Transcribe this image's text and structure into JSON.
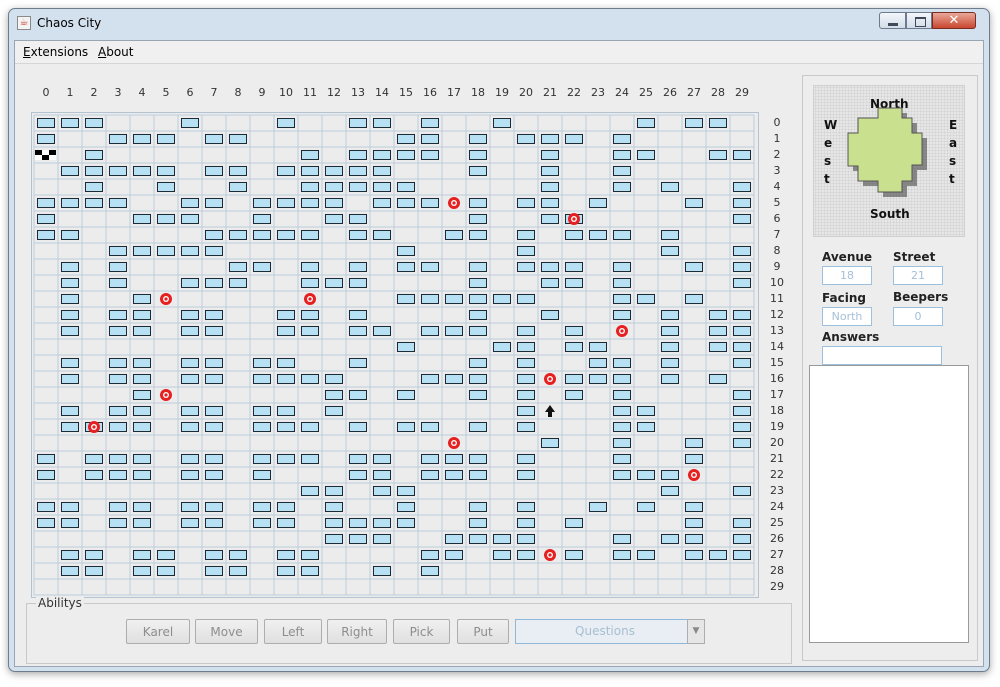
{
  "window": {
    "title": "Chaos City",
    "close_glyph": "✕"
  },
  "menu": {
    "items": [
      "Extensions",
      "About"
    ]
  },
  "grid": {
    "columns": 30,
    "rows": 30,
    "column_labels": [
      "0",
      "1",
      "2",
      "3",
      "4",
      "5",
      "6",
      "7",
      "8",
      "9",
      "10",
      "11",
      "12",
      "13",
      "14",
      "15",
      "16",
      "17",
      "18",
      "19",
      "20",
      "21",
      "22",
      "23",
      "24",
      "25",
      "26",
      "27",
      "28",
      "29"
    ],
    "row_labels": [
      "0",
      "1",
      "2",
      "3",
      "4",
      "5",
      "6",
      "7",
      "8",
      "9",
      "10",
      "11",
      "12",
      "13",
      "14",
      "15",
      "16",
      "17",
      "18",
      "19",
      "20",
      "21",
      "22",
      "23",
      "24",
      "25",
      "26",
      "27",
      "28",
      "29"
    ],
    "walls": [
      "111000100010011010010000010110",
      "100111011000000110101110100000",
      "001000000001011110100100110011",
      "011111011011111000100100100000",
      "001001001001111100000100101001",
      "111100110111101110101101000101",
      "100011100100110000100110000001",
      "110000011111011001101011101000",
      "000111110000000100001000001001",
      "010100001101010110101110100101",
      "010100111001110000100110100001",
      "010010000000000111111000110100",
      "010110110011010000100100101011",
      "010110110011011011101010001011",
      "000000000000000100011011001011",
      "010110110110010000101001101001",
      "010110110111100011101011101010",
      "000010000000110100101010100001",
      "010110110110100000001000110001",
      "011110110111010110101000110001",
      "000000000000000000000100100101",
      "101110110111011011101000100100",
      "101110110100011011101000111000",
      "000000000001101100000000001001",
      "110110110110100100101001010100",
      "110110110110111100101010000101",
      "000000000000111001111000101101",
      "011011011011000011011010110111",
      "011011011011001010000000000000",
      "000000000000000000000000000000"
    ],
    "beepers": [
      [
        17,
        5
      ],
      [
        22,
        6
      ],
      [
        5,
        11
      ],
      [
        11,
        11
      ],
      [
        24,
        13
      ],
      [
        21,
        16
      ],
      [
        5,
        17
      ],
      [
        2,
        19
      ],
      [
        17,
        20
      ],
      [
        27,
        22
      ],
      [
        21,
        27
      ]
    ],
    "home": {
      "avenue": 0,
      "street": 2
    },
    "robot": {
      "avenue": 21,
      "street": 18,
      "facing": "North",
      "glyph": "▲"
    }
  },
  "abilitys": {
    "label": "Abilitys",
    "buttons": [
      "Karel",
      "Move",
      "Left",
      "Right",
      "Pick",
      "Put"
    ],
    "questions_placeholder": "Questions",
    "dropdown_glyph": "▼"
  },
  "compass": {
    "north": "North",
    "south": "South",
    "west": "W\ne\ns\nt",
    "east": "E\na\ns\nt"
  },
  "status": {
    "avenue_label": "Avenue",
    "avenue_value": "18",
    "street_label": "Street",
    "street_value": "21",
    "facing_label": "Facing",
    "facing_value": "North",
    "beepers_label": "Beepers",
    "beepers_value": "0",
    "answers_label": "Answers",
    "answers_value": ""
  },
  "colors": {
    "wall_fill": "#b6e0f4",
    "wall_border": "#1f2a34",
    "beeper": "#e62020",
    "grid_line": "#bccbdb",
    "compass_fill": "#c9e08f"
  }
}
